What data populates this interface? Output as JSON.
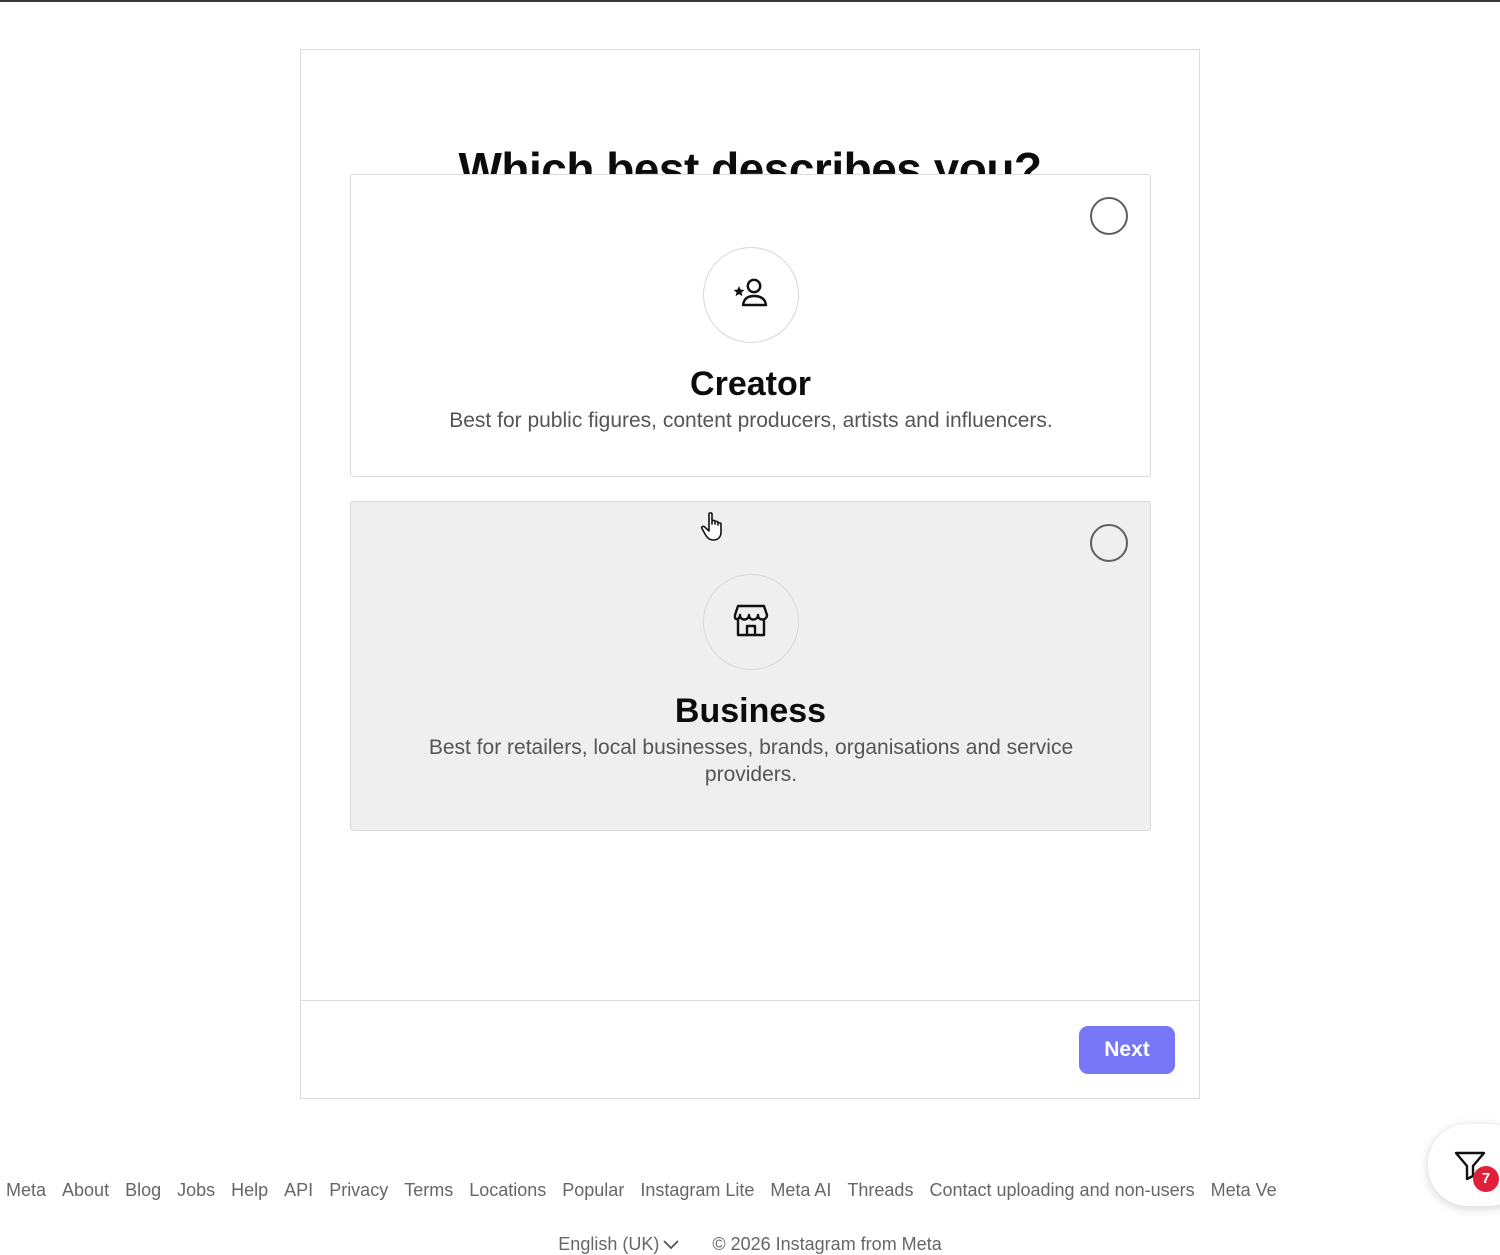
{
  "page": {
    "title": "Which best describes you?"
  },
  "options": [
    {
      "id": "creator",
      "title": "Creator",
      "description": "Best for public figures, content producers, artists and influencers.",
      "icon": "person-star-icon",
      "selected": false
    },
    {
      "id": "business",
      "title": "Business",
      "description": "Best for retailers, local businesses, brands, organisations and service providers.",
      "icon": "storefront-icon",
      "selected": false
    }
  ],
  "actions": {
    "next_label": "Next",
    "next_color": "#7676f7"
  },
  "footer": {
    "links": [
      "Meta",
      "About",
      "Blog",
      "Jobs",
      "Help",
      "API",
      "Privacy",
      "Terms",
      "Locations",
      "Popular",
      "Instagram Lite",
      "Meta AI",
      "Threads",
      "Contact uploading and non-users",
      "Meta Ve"
    ],
    "language": "English (UK)",
    "copyright": "© 2026 Instagram from Meta"
  },
  "widget": {
    "icon": "filter-icon",
    "badge_count": "7",
    "badge_color": "#e0203a"
  }
}
